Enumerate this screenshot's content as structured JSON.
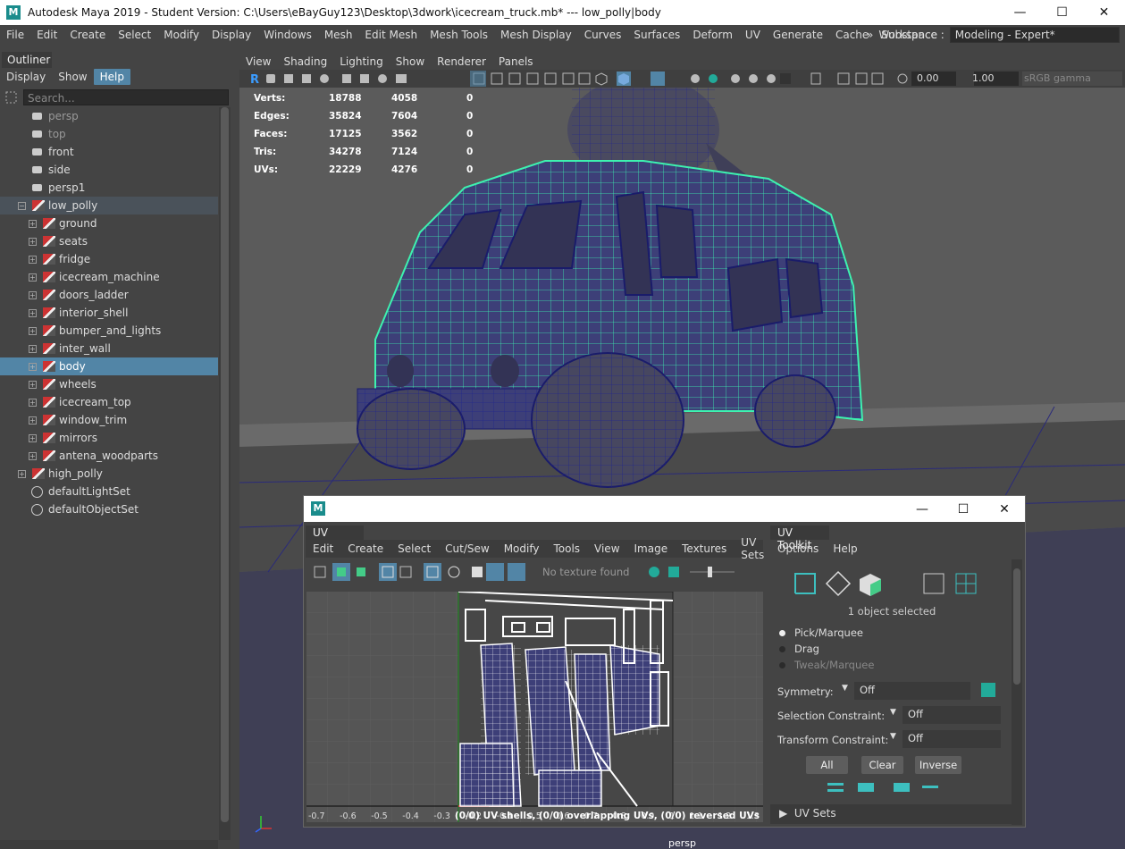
{
  "window": {
    "title": "Autodesk Maya 2019 - Student Version: C:\\Users\\eBayGuy123\\Desktop\\3dwork\\icecream_truck.mb*  ---  low_polly|body",
    "logo": "M",
    "minimize": "—",
    "maximize": "☐",
    "close": "✕"
  },
  "menubar": {
    "items": [
      "File",
      "Edit",
      "Create",
      "Select",
      "Modify",
      "Display",
      "Windows",
      "Mesh",
      "Edit Mesh",
      "Mesh Tools",
      "Mesh Display",
      "Curves",
      "Surfaces",
      "Deform",
      "UV",
      "Generate",
      "Cache",
      "Substance"
    ],
    "workspace_label": "Workspace :",
    "workspace_value": "Modeling - Expert*",
    "overflow": "»"
  },
  "outliner": {
    "tab": "Outliner",
    "menu": [
      "Display",
      "Show",
      "Help"
    ],
    "search_placeholder": "Search...",
    "items": [
      {
        "label": "persp",
        "type": "camera",
        "dim": true
      },
      {
        "label": "top",
        "type": "camera",
        "dim": true
      },
      {
        "label": "front",
        "type": "camera",
        "dim": false
      },
      {
        "label": "side",
        "type": "camera",
        "dim": false
      },
      {
        "label": "persp1",
        "type": "camera",
        "dim": false
      },
      {
        "label": "low_polly",
        "type": "group",
        "expanded": true
      },
      {
        "label": "ground",
        "type": "mesh"
      },
      {
        "label": "seats",
        "type": "mesh"
      },
      {
        "label": "fridge",
        "type": "mesh"
      },
      {
        "label": "icecream_machine",
        "type": "mesh"
      },
      {
        "label": "doors_ladder",
        "type": "mesh"
      },
      {
        "label": "interior_shell",
        "type": "mesh"
      },
      {
        "label": "bumper_and_lights",
        "type": "mesh"
      },
      {
        "label": "inter_wall",
        "type": "mesh"
      },
      {
        "label": "body",
        "type": "mesh",
        "selected": true
      },
      {
        "label": "wheels",
        "type": "mesh"
      },
      {
        "label": "icecream_top",
        "type": "mesh"
      },
      {
        "label": "window_trim",
        "type": "mesh"
      },
      {
        "label": "mirrors",
        "type": "mesh"
      },
      {
        "label": "antena_woodparts",
        "type": "mesh"
      },
      {
        "label": "high_polly",
        "type": "group",
        "expanded": false
      },
      {
        "label": "defaultLightSet",
        "type": "set"
      },
      {
        "label": "defaultObjectSet",
        "type": "set"
      }
    ]
  },
  "viewport": {
    "menu": [
      "View",
      "Shading",
      "Lighting",
      "Show",
      "Renderer",
      "Panels"
    ],
    "exposure": "0.00",
    "gamma": "1.00",
    "color_space": "sRGB gamma",
    "camera_label": "persp",
    "hud": [
      {
        "key": "Verts:",
        "v1": "18788",
        "v2": "4058",
        "v3": "0"
      },
      {
        "key": "Edges:",
        "v1": "35824",
        "v2": "7604",
        "v3": "0"
      },
      {
        "key": "Faces:",
        "v1": "17125",
        "v2": "3562",
        "v3": "0"
      },
      {
        "key": "Tris:",
        "v1": "34278",
        "v2": "7124",
        "v3": "0"
      },
      {
        "key": "UVs:",
        "v1": "22229",
        "v2": "4276",
        "v3": "0"
      }
    ]
  },
  "uv_window": {
    "logo": "M",
    "minimize": "—",
    "maximize": "☐",
    "close": "✕",
    "editor": {
      "tab": "UV Editor",
      "menu": [
        "Edit",
        "Create",
        "Select",
        "Cut/Sew",
        "Modify",
        "Tools",
        "View",
        "Image",
        "Textures",
        "UV Sets"
      ],
      "overflow": "»",
      "texture_status": "No texture found",
      "axis_labels": [
        "-0.7",
        "-0.6",
        "-0.5",
        "-0.4",
        "-0.3",
        "-0.2",
        "-0.1",
        "0.5",
        "0.6",
        "0.7",
        "0.8",
        "0.9",
        "1",
        "1.1",
        "1.2",
        "1.3"
      ],
      "status": "(0/0) UV shells, (0/0) overlapping UVs, (0/0) reversed UVs"
    },
    "toolkit": {
      "tab": "UV Toolkit",
      "menu": [
        "Options",
        "Help"
      ],
      "selection_status": "1 object selected",
      "modes": [
        {
          "label": "Pick/Marquee",
          "on": true
        },
        {
          "label": "Drag",
          "on": false
        },
        {
          "label": "Tweak/Marquee",
          "on": false
        }
      ],
      "symmetry_label": "Symmetry:",
      "symmetry_value": "Off",
      "selection_constraint_label": "Selection Constraint:",
      "selection_constraint_value": "Off",
      "transform_constraint_label": "Transform Constraint:",
      "transform_constraint_value": "Off",
      "buttons": [
        "All",
        "Clear",
        "Inverse"
      ],
      "uv_sets_label": "UV Sets"
    }
  },
  "colors": {
    "selection": "#5285a6",
    "wire_green": "#3df2b0",
    "mesh_blue": "#3d3f78",
    "maya_teal": "#1a8c8c"
  }
}
